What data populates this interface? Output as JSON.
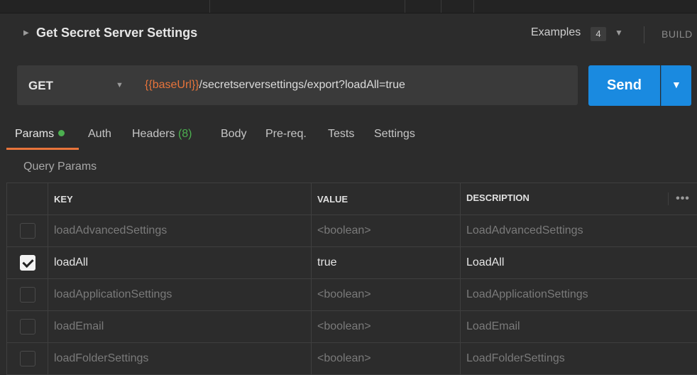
{
  "request": {
    "title": "Get Secret Server Settings",
    "examples_label": "Examples",
    "examples_count": "4",
    "build_label": "BUILD"
  },
  "urlbar": {
    "method": "GET",
    "url_var": "{{baseUrl}}",
    "url_path": "/secretserversettings/export?loadAll=true",
    "send_label": "Send"
  },
  "tabs": [
    {
      "label": "Params",
      "indicator": "green-dot"
    },
    {
      "label": "Auth"
    },
    {
      "label": "Headers",
      "count": "(8)"
    },
    {
      "label": "Body"
    },
    {
      "label": "Pre-req."
    },
    {
      "label": "Tests"
    },
    {
      "label": "Settings"
    }
  ],
  "query_params": {
    "section_label": "Query Params",
    "columns": [
      "KEY",
      "VALUE",
      "DESCRIPTION"
    ],
    "rows": [
      {
        "checked": false,
        "key": "loadAdvancedSettings",
        "value": "<boolean>",
        "description": "LoadAdvancedSettings"
      },
      {
        "checked": true,
        "key": "loadAll",
        "value": "true",
        "description": "LoadAll"
      },
      {
        "checked": false,
        "key": "loadApplicationSettings",
        "value": "<boolean>",
        "description": "LoadApplicationSettings"
      },
      {
        "checked": false,
        "key": "loadEmail",
        "value": "<boolean>",
        "description": "LoadEmail"
      },
      {
        "checked": false,
        "key": "loadFolderSettings",
        "value": "<boolean>",
        "description": "LoadFolderSettings"
      }
    ]
  },
  "colors": {
    "accent_send": "#1a8ae0",
    "active_tab_underline": "#e8743b",
    "variable": "#e8743b",
    "status_green": "#4caf50"
  }
}
